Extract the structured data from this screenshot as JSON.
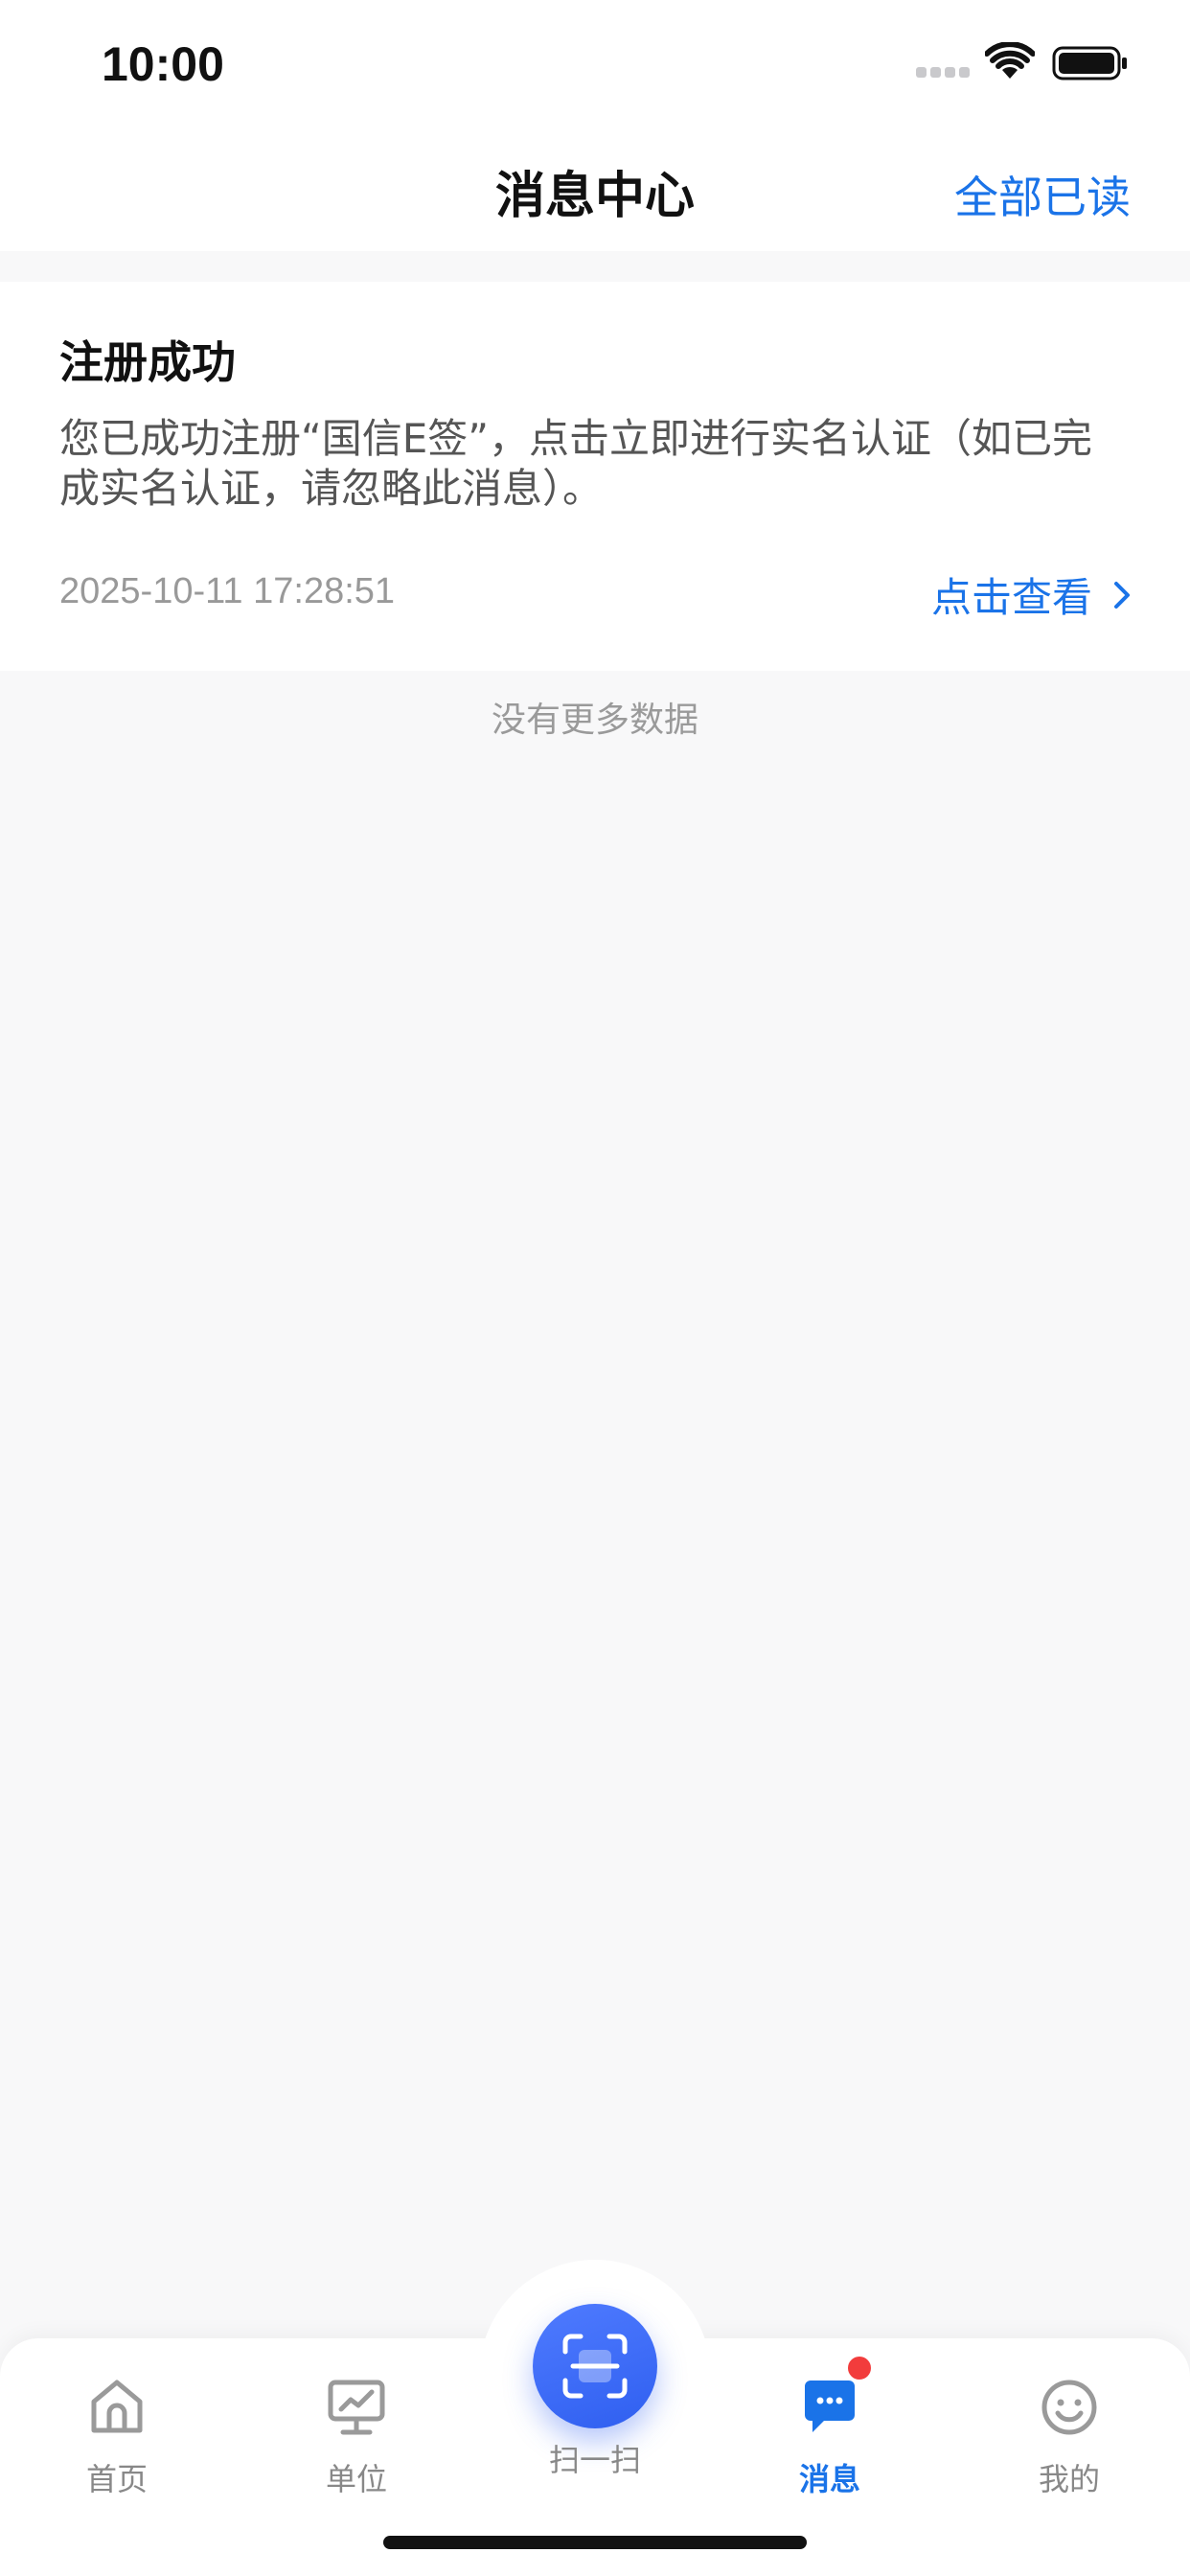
{
  "status_bar": {
    "time": "10:00"
  },
  "header": {
    "title": "消息中心",
    "mark_all_read": "全部已读"
  },
  "messages": [
    {
      "title": "注册成功",
      "body": "您已成功注册“国信E签”，点击立即进行实名认证（如已完成实名认证，请忽略此消息）。",
      "timestamp": "2025-10-11 17:28:51",
      "action_label": "点击查看"
    }
  ],
  "list_footer": "没有更多数据",
  "tabbar": {
    "items": [
      {
        "label": "首页",
        "icon": "home-icon"
      },
      {
        "label": "单位",
        "icon": "monitor-chart-icon"
      },
      {
        "label": "扫一扫",
        "icon": "scan-icon"
      },
      {
        "label": "消息",
        "icon": "chat-bubble-icon",
        "active": true,
        "has_badge": true
      },
      {
        "label": "我的",
        "icon": "smiley-icon"
      }
    ]
  },
  "colors": {
    "accent": "#1a73e8",
    "badge": "#f23c3c",
    "background": "#f8f8f9"
  }
}
